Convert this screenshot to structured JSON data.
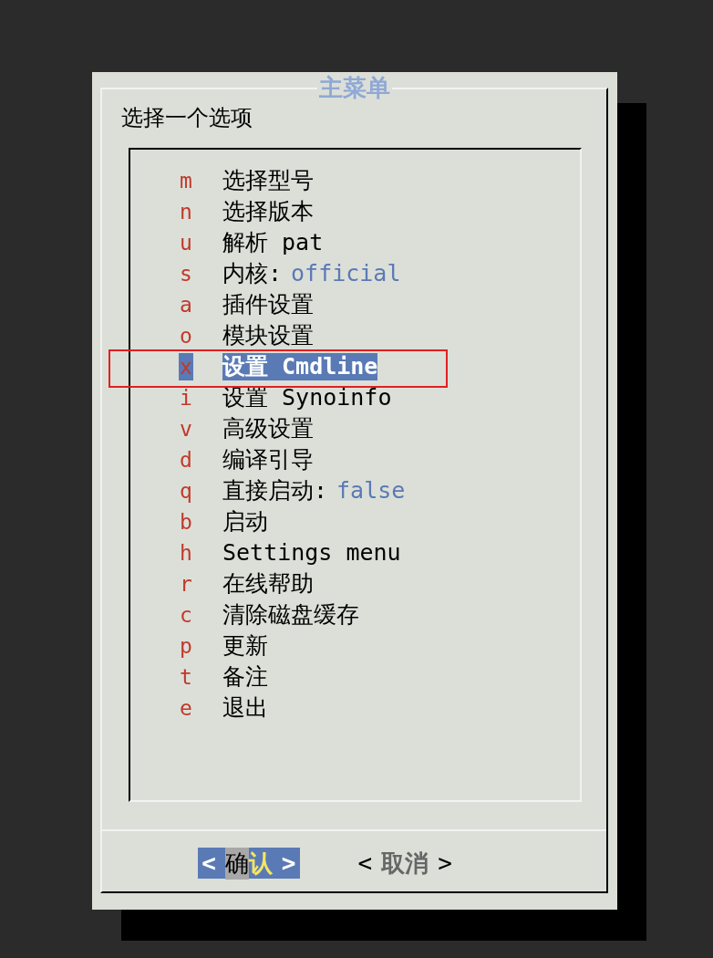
{
  "dialog": {
    "title": "主菜单",
    "prompt": "选择一个选项"
  },
  "menu": [
    {
      "key": "m",
      "label": "选择型号",
      "selected": false
    },
    {
      "key": "n",
      "label": "选择版本",
      "selected": false
    },
    {
      "key": "u",
      "label": "解析 pat",
      "selected": false
    },
    {
      "key": "s",
      "label": "内核:",
      "value": "official",
      "selected": false
    },
    {
      "key": "a",
      "label": "插件设置",
      "selected": false
    },
    {
      "key": "o",
      "label": "模块设置",
      "selected": false
    },
    {
      "key": "x",
      "label": "设置 Cmdline",
      "selected": true
    },
    {
      "key": "i",
      "label": "设置 Synoinfo",
      "selected": false
    },
    {
      "key": "v",
      "label": "高级设置",
      "selected": false
    },
    {
      "key": "d",
      "label": "编译引导",
      "selected": false
    },
    {
      "key": "q",
      "label": "直接启动:",
      "value": "false",
      "selected": false
    },
    {
      "key": "b",
      "label": "启动",
      "selected": false
    },
    {
      "key": "h",
      "label": "Settings menu",
      "selected": false
    },
    {
      "key": "r",
      "label": "在线帮助",
      "selected": false
    },
    {
      "key": "c",
      "label": "清除磁盘缓存",
      "selected": false
    },
    {
      "key": "p",
      "label": "更新",
      "selected": false
    },
    {
      "key": "t",
      "label": "备注",
      "selected": false
    },
    {
      "key": "e",
      "label": "退出",
      "selected": false
    }
  ],
  "buttons": [
    {
      "left": "<",
      "cursor_part": "确",
      "rest": "认",
      "right": ">",
      "selected": true
    },
    {
      "left": "<",
      "rest": "取消",
      "right": ">",
      "selected": false
    }
  ]
}
